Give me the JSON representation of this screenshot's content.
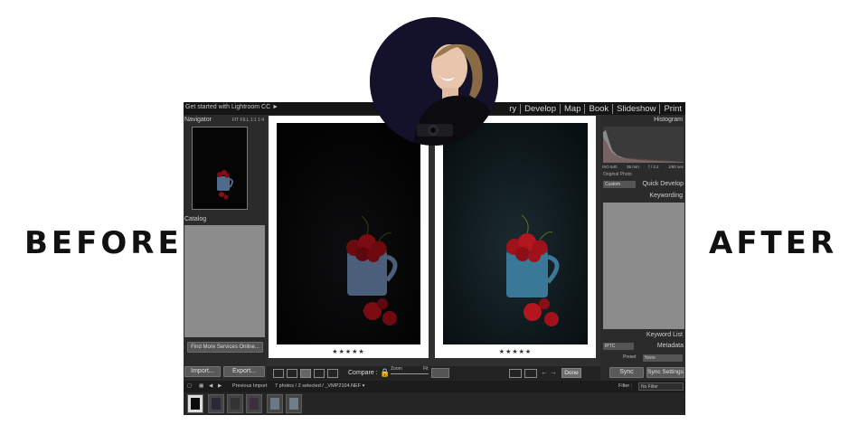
{
  "labels": {
    "before": "BEFORE",
    "after": "AFTER"
  },
  "lightroom": {
    "get_started": "Get started with Lightroom CC ►",
    "modules": [
      "ry",
      "Develop",
      "Map",
      "Book",
      "Slideshow",
      "Print"
    ],
    "left_panel": {
      "navigator": "Navigator",
      "nav_options": "FIT   FILL   1:1   1:4",
      "catalog": "Catalog",
      "find_more": "Find More Services Online...",
      "import": "Import...",
      "export": "Export..."
    },
    "center": {
      "stars_left": "★★★★★",
      "stars_right": "★★★★★",
      "compare": "Compare :",
      "zoom": "Zoom",
      "fit": "Fit",
      "done": "Done"
    },
    "right_panel": {
      "histogram": "Histogram",
      "exif": [
        "ISO 640",
        "35 mm",
        "f / 2.2",
        "1/60 sec"
      ],
      "original_photo": "Original Photo",
      "custom": "Custom",
      "quick_develop": "Quick Develop",
      "keywording": "Keywording",
      "keyword_list": "Keyword List",
      "iptc": "IPTC",
      "metadata": "Metadata",
      "preset_label": "Preset",
      "preset_value": "None",
      "sync": "Sync",
      "sync_settings": "Sync Settings"
    },
    "filmstrip": {
      "previous_import": "Previous Import",
      "selection": "7 photos / 2 selected / _VMP2104.NEF ▾",
      "filter_label": "Filter :",
      "filter_value": "No Filter"
    }
  },
  "colors": {
    "app_bg": "#3b3b3b",
    "panel_bg": "#2b2b2b",
    "topbar_bg": "#151515",
    "mug_before": "#4f6b8c",
    "mug_after": "#3d7fa0",
    "cherry": "#8b0d15"
  },
  "icons": [
    "lock-icon",
    "grid-view-icon",
    "loupe-view-icon",
    "compare-view-icon",
    "survey-view-icon",
    "people-view-icon",
    "back-arrow-icon",
    "forward-arrow-icon"
  ]
}
